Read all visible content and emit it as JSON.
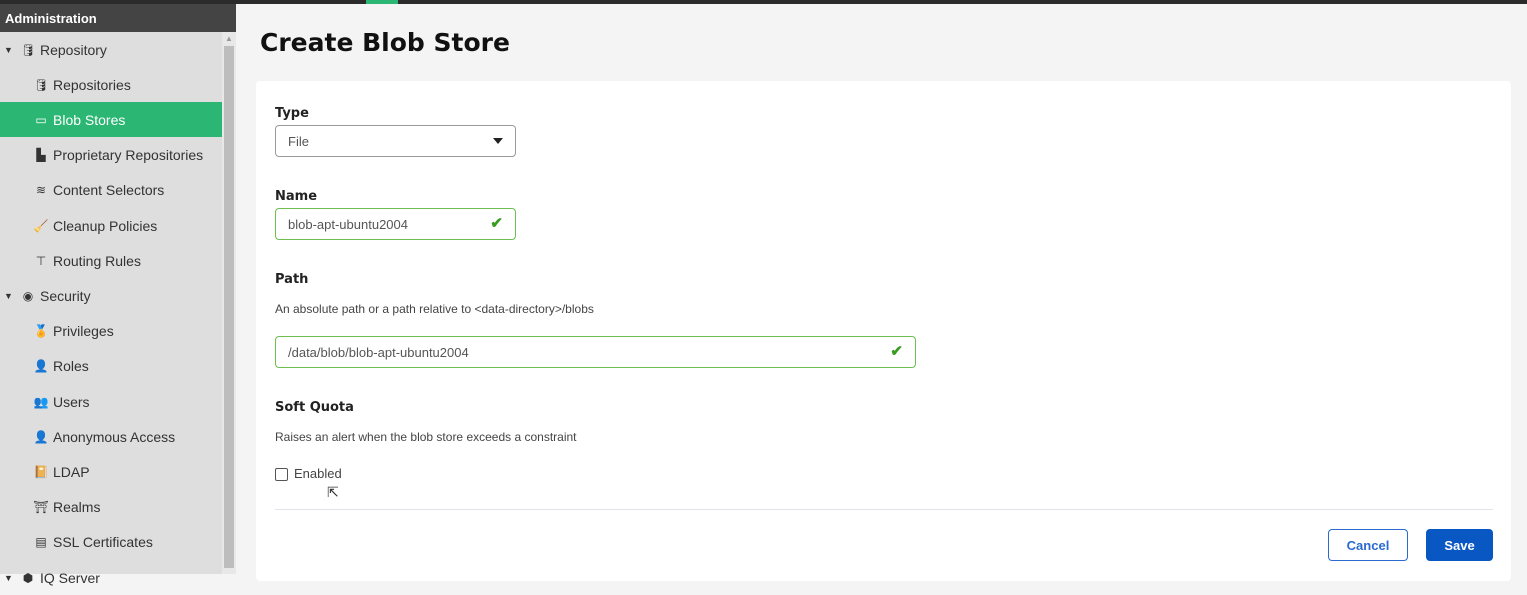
{
  "sidebar": {
    "title": "Administration",
    "items": [
      {
        "label": "Repository",
        "icon": "database-icon",
        "group": true
      },
      {
        "label": "Repositories",
        "icon": "database-icon"
      },
      {
        "label": "Blob Stores",
        "icon": "hard-drive-icon",
        "selected": true
      },
      {
        "label": "Proprietary Repositories",
        "icon": "door-icon"
      },
      {
        "label": "Content Selectors",
        "icon": "layers-icon"
      },
      {
        "label": "Cleanup Policies",
        "icon": "broom-icon"
      },
      {
        "label": "Routing Rules",
        "icon": "signpost-icon"
      },
      {
        "label": "Security",
        "icon": "badge-icon",
        "group": true
      },
      {
        "label": "Privileges",
        "icon": "medal-icon"
      },
      {
        "label": "Roles",
        "icon": "user-tag-icon"
      },
      {
        "label": "Users",
        "icon": "users-icon"
      },
      {
        "label": "Anonymous Access",
        "icon": "user-icon"
      },
      {
        "label": "LDAP",
        "icon": "book-icon"
      },
      {
        "label": "Realms",
        "icon": "gate-icon"
      },
      {
        "label": "SSL Certificates",
        "icon": "certificate-icon"
      },
      {
        "label": "IQ Server",
        "icon": "server-icon",
        "group": true
      }
    ]
  },
  "page": {
    "title": "Create Blob Store"
  },
  "form": {
    "type": {
      "label": "Type",
      "value": "File"
    },
    "name": {
      "label": "Name",
      "value": "blob-apt-ubuntu2004"
    },
    "path": {
      "label": "Path",
      "help": "An absolute path or a path relative to <data-directory>/blobs",
      "value": "/data/blob/blob-apt-ubuntu2004"
    },
    "quota": {
      "label": "Soft Quota",
      "help": "Raises an alert when the blob store exceeds a constraint",
      "checkbox": "Enabled",
      "checked": false
    },
    "cancel": "Cancel",
    "save": "Save"
  },
  "colors": {
    "accent": "#2bb673",
    "primary": "#0957c3",
    "valid": "#6cbf4f"
  }
}
